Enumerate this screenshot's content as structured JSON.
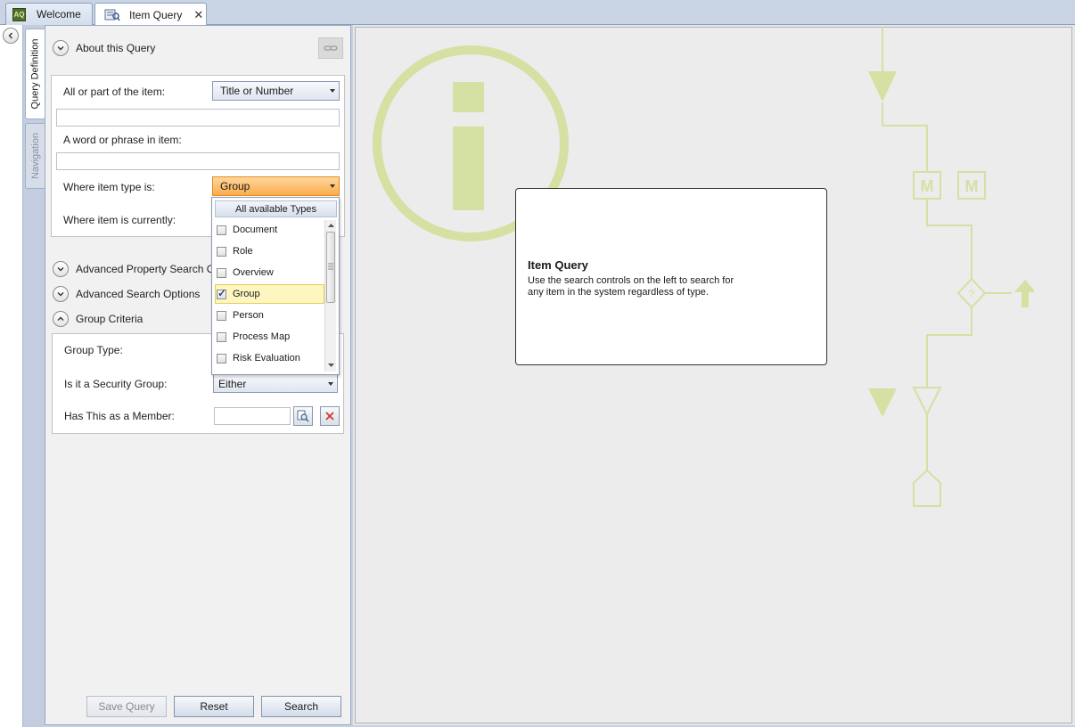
{
  "tabs": [
    {
      "label": "Welcome",
      "icon": "app-logo-icon"
    },
    {
      "label": "Item Query",
      "icon": "query-icon",
      "close": "✕"
    }
  ],
  "side_tabs": {
    "query_definition": "Query Definition",
    "navigation": "Navigation"
  },
  "query": {
    "about": "About this Query",
    "field_all_or_part": "All or part of the item:",
    "combo_title_or_number": "Title or Number",
    "field_word_phrase": "A word or phrase in item:",
    "field_item_type": "Where item type is:",
    "combo_item_type": "Group",
    "field_currently": "Where item is currently:",
    "advanced_property": "Advanced Property Search Options",
    "advanced_search": "Advanced Search Options",
    "group_criteria": "Group Criteria",
    "group_type": "Group Type:",
    "security_group": "Is it a Security Group:",
    "security_value": "Either",
    "has_member": "Has This as a Member:"
  },
  "dropdown": {
    "header": "All available Types",
    "items": [
      {
        "label": "Document",
        "checked": false
      },
      {
        "label": "Role",
        "checked": false
      },
      {
        "label": "Overview",
        "checked": false
      },
      {
        "label": "Group",
        "checked": true
      },
      {
        "label": "Person",
        "checked": false
      },
      {
        "label": "Process Map",
        "checked": false
      },
      {
        "label": "Risk Evaluation",
        "checked": false
      }
    ]
  },
  "buttons": {
    "save": "Save Query",
    "reset": "Reset",
    "search": "Search"
  },
  "info": {
    "title": "Item Query",
    "body_line1": "Use the search controls on the left to search for",
    "body_line2": "any item in the system regardless of type."
  },
  "graphic": {
    "m1": "M",
    "m2": "M",
    "decision": "?"
  },
  "colors": {
    "accent_green": "#d5e0a3",
    "combo_orange": "#fbad4c",
    "selection_yellow": "#fdf6c0"
  }
}
